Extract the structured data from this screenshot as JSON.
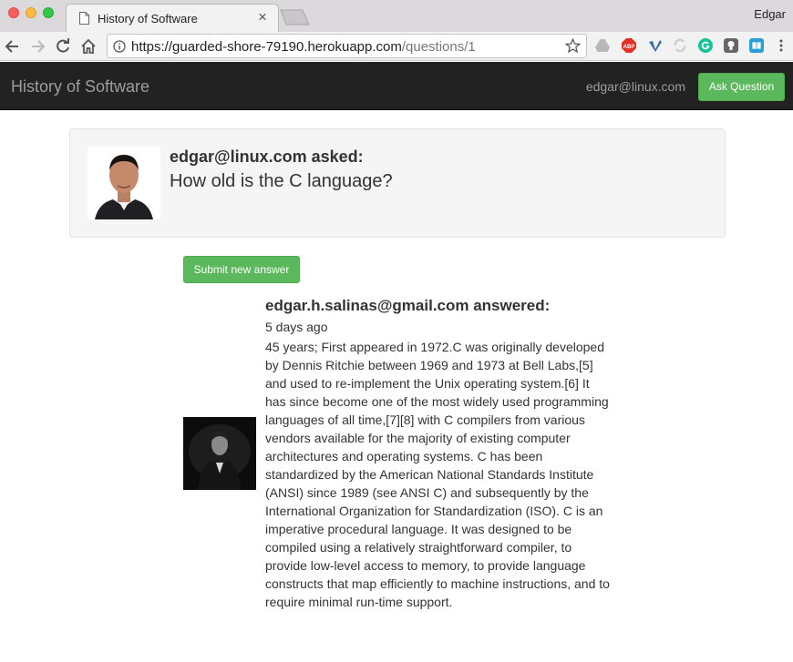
{
  "browser": {
    "tab_title": "History of Software",
    "tab_close": "×",
    "profile_name": "Edgar",
    "url_base": "https://guarded-shore-79190.herokuapp.com",
    "url_path": "/questions/1",
    "icons": [
      "back-icon",
      "forward-icon",
      "reload-icon",
      "home-icon",
      "info-icon",
      "bookmark-star-icon",
      "drive-extension-icon",
      "adblock-extension-icon",
      "vimeo-extension-icon",
      "sync-extension-icon",
      "grammarly-extension-icon",
      "bulb-extension-icon",
      "reader-extension-icon",
      "menu-icon"
    ]
  },
  "navbar": {
    "brand": "History of Software",
    "user_email": "edgar@linux.com",
    "ask_button": "Ask Question"
  },
  "question": {
    "asker_line": "edgar@linux.com asked:",
    "text": "How old is the C language?"
  },
  "actions": {
    "submit_answer": "Submit new answer"
  },
  "answer": {
    "answerer_line": "edgar.h.salinas@gmail.com answered:",
    "time": "5 days ago",
    "body": "45 years; First appeared in 1972.C was originally developed by Dennis Ritchie between 1969 and 1973 at Bell Labs,[5] and used to re-implement the Unix operating system.[6] It has since become one of the most widely used programming languages of all time,[7][8] with C compilers from various vendors available for the majority of existing computer architectures and operating systems. C has been standardized by the American National Standards Institute (ANSI) since 1989 (see ANSI C) and subsequently by the International Organization for Standardization (ISO). C is an imperative procedural language. It was designed to be compiled using a relatively straightforward compiler, to provide low-level access to memory, to provide language constructs that map efficiently to machine instructions, and to require minimal run-time support."
  },
  "colors": {
    "navbar_bg": "#222222",
    "brand_text": "#9d9d9d",
    "success_green": "#5cb85c",
    "well_bg": "#f5f5f5"
  }
}
